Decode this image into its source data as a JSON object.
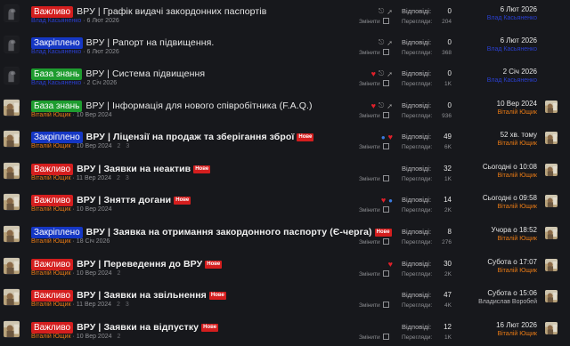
{
  "threads": [
    {
      "prefix": "Важливо",
      "prefix_type": "important",
      "title": "ВРУ | Графік видачі закордонних паспортів",
      "bold": false,
      "new_badge": "",
      "author": "Влад Касьяненко",
      "author_color": "blue",
      "date": "6 Лют 2026",
      "pages": "",
      "icons": "🔒 🖈",
      "edit": "Змінити",
      "replies_label": "Відповіді:",
      "replies": "0",
      "views_label": "Перегляди:",
      "views": "204",
      "last_date": "6 Лют 2026",
      "last_user": "Влад Касьяненко",
      "last_user_color": "blue",
      "avatar": "dark",
      "mini_avatar": "none"
    },
    {
      "prefix": "Закріплено",
      "prefix_type": "pinned",
      "title": "ВРУ | Рапорт на підвищення.",
      "bold": false,
      "new_badge": "",
      "author": "Влад Касьяненко",
      "author_color": "blue",
      "date": "6 Лют 2026",
      "pages": "",
      "icons": "🔒 🖈",
      "edit": "Змінити",
      "replies_label": "Відповіді:",
      "replies": "0",
      "views_label": "Перегляди:",
      "views": "368",
      "last_date": "6 Лют 2026",
      "last_user": "Влад Касьяненко",
      "last_user_color": "blue",
      "avatar": "dark",
      "mini_avatar": "none"
    },
    {
      "prefix": "База знань",
      "prefix_type": "kb",
      "title": "ВРУ | Система підвищення",
      "bold": false,
      "new_badge": "",
      "author": "Влад Касьяненко",
      "author_color": "blue",
      "date": "2 Січ 2026",
      "pages": "",
      "icons": "♥ 🔒 🖈",
      "edit": "Змінити",
      "replies_label": "Відповіді:",
      "replies": "0",
      "views_label": "Перегляди:",
      "views": "1K",
      "last_date": "2 Січ 2026",
      "last_user": "Влад Касьяненко",
      "last_user_color": "blue",
      "avatar": "dark",
      "mini_avatar": "none"
    },
    {
      "prefix": "База знань",
      "prefix_type": "kb",
      "title": "ВРУ | Інформація для нового співробітника (F.A.Q.)",
      "bold": false,
      "new_badge": "",
      "author": "Віталій Ющик",
      "author_color": "orange",
      "date": "10 Вер 2024",
      "pages": "",
      "icons": "♥ 🔒 🖈",
      "edit": "Змінити",
      "replies_label": "Відповіді:",
      "replies": "0",
      "views_label": "Перегляди:",
      "views": "936",
      "last_date": "10 Вер 2024",
      "last_user": "Віталій Ющик",
      "last_user_color": "orange",
      "avatar": "photo",
      "mini_avatar": "photo"
    },
    {
      "prefix": "Закріплено",
      "prefix_type": "pinned",
      "title": "ВРУ | Ліцензії на продаж та зберігання зброї",
      "bold": true,
      "new_badge": "Нове",
      "author": "Віталій Ющик",
      "author_color": "orange",
      "date": "10 Вер 2024",
      "pages": "2  3",
      "icons": "👍 ♥",
      "edit": "Змінити",
      "replies_label": "Відповіді:",
      "replies": "49",
      "views_label": "Перегляди:",
      "views": "6K",
      "last_date": "52 хв. тому",
      "last_user": "Віталій Ющик",
      "last_user_color": "orange",
      "avatar": "photo",
      "mini_avatar": "photo"
    },
    {
      "prefix": "Важливо",
      "prefix_type": "important",
      "title": "ВРУ | Заявки на неактив",
      "bold": true,
      "new_badge": "Нове",
      "author": "Віталій Ющик",
      "author_color": "orange",
      "date": "11 Вер 2024",
      "pages": "2  3",
      "icons": "",
      "edit": "Змінити",
      "replies_label": "Відповіді:",
      "replies": "32",
      "views_label": "Перегляди:",
      "views": "1K",
      "last_date": "Сьогодні о 10:08",
      "last_user": "Віталій Ющик",
      "last_user_color": "orange",
      "avatar": "photo",
      "mini_avatar": "photo"
    },
    {
      "prefix": "Важливо",
      "prefix_type": "important",
      "title": "ВРУ | Зняття догани",
      "bold": true,
      "new_badge": "Нове",
      "author": "Віталій Ющик",
      "author_color": "orange",
      "date": "10 Вер 2024",
      "pages": "",
      "icons": "♥ 👍",
      "edit": "Змінити",
      "replies_label": "Відповіді:",
      "replies": "14",
      "views_label": "Перегляди:",
      "views": "2K",
      "last_date": "Сьогодні о 09:58",
      "last_user": "Віталій Ющик",
      "last_user_color": "orange",
      "avatar": "photo",
      "mini_avatar": "photo"
    },
    {
      "prefix": "Закріплено",
      "prefix_type": "pinned",
      "title": "ВРУ | Заявка на отримання закордонного паспорту (Є-черга)",
      "bold": true,
      "new_badge": "Нове",
      "author": "Віталій Ющик",
      "author_color": "orange",
      "date": "18 Січ 2026",
      "pages": "",
      "icons": "",
      "edit": "Змінити",
      "replies_label": "Відповіді:",
      "replies": "8",
      "views_label": "Перегляди:",
      "views": "276",
      "last_date": "Учора о 18:52",
      "last_user": "Віталій Ющик",
      "last_user_color": "orange",
      "avatar": "photo",
      "mini_avatar": "photo"
    },
    {
      "prefix": "Важливо",
      "prefix_type": "important",
      "title": "ВРУ | Переведення до ВРУ",
      "bold": true,
      "new_badge": "Нове",
      "author": "Віталій Ющик",
      "author_color": "orange",
      "date": "10 Вер 2024",
      "pages": "2",
      "icons": "♥",
      "edit": "Змінити",
      "replies_label": "Відповіді:",
      "replies": "30",
      "views_label": "Перегляди:",
      "views": "2K",
      "last_date": "Субота о 17:07",
      "last_user": "Віталій Ющик",
      "last_user_color": "orange",
      "avatar": "photo",
      "mini_avatar": "photo"
    },
    {
      "prefix": "Важливо",
      "prefix_type": "important",
      "title": "ВРУ | Заявки на звільнення",
      "bold": true,
      "new_badge": "Нове",
      "author": "Віталій Ющик",
      "author_color": "orange",
      "date": "11 Вер 2024",
      "pages": "2  3",
      "icons": "",
      "edit": "Змінити",
      "replies_label": "Відповіді:",
      "replies": "47",
      "views_label": "Перегляди:",
      "views": "4K",
      "last_date": "Субота о 15:06",
      "last_user": "Владислав Воробей",
      "last_user_color": "plain",
      "avatar": "photo",
      "mini_avatar": "photo"
    },
    {
      "prefix": "Важливо",
      "prefix_type": "important",
      "title": "ВРУ | Заявки на відпустку",
      "bold": true,
      "new_badge": "Нове",
      "author": "Віталій Ющик",
      "author_color": "orange",
      "date": "10 Вер 2024",
      "pages": "2",
      "icons": "",
      "edit": "Змінити",
      "replies_label": "Відповіді:",
      "replies": "12",
      "views_label": "Перегляди:",
      "views": "1K",
      "last_date": "16 Лют 2026",
      "last_user": "Віталій Ющик",
      "last_user_color": "orange",
      "avatar": "photo",
      "mini_avatar": "photo"
    }
  ]
}
